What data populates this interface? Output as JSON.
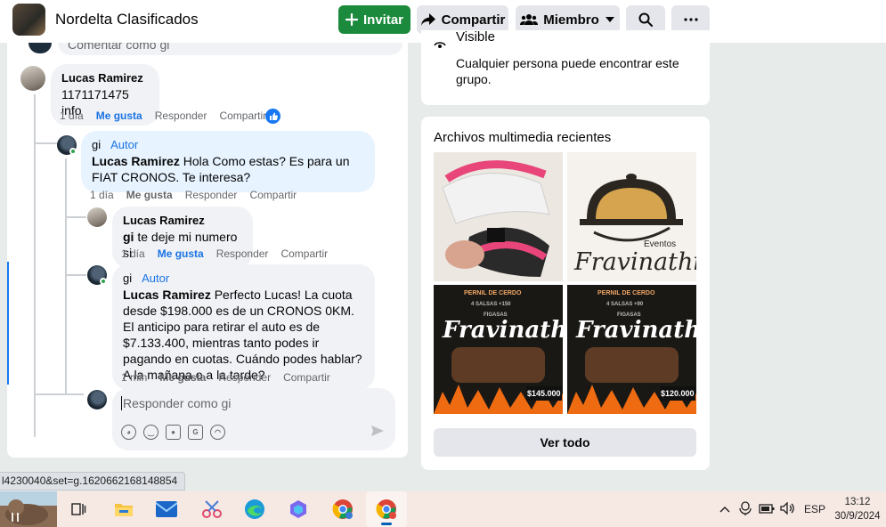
{
  "header": {
    "group_name": "Nordelta Clasificados",
    "invite_label": "Invitar",
    "share_label": "Compartir",
    "member_label": "Miembro"
  },
  "top_comment_box": {
    "placeholder": "Comentar como gi"
  },
  "comments": [
    {
      "author": "Lucas Ramirez",
      "text": "1171171475 info",
      "time": "1 día",
      "like": "Me gusta",
      "reply": "Responder",
      "share": "Compartir"
    },
    {
      "author": "gi",
      "badge": "Autor",
      "mention": "Lucas Ramirez",
      "text": " Hola Como estas? Es para un FIAT CRONOS. Te interesa?",
      "time": "1 día",
      "like": "Me gusta",
      "reply": "Responder",
      "share": "Compartir"
    },
    {
      "author": "Lucas Ramirez",
      "mention": "gi",
      "text": " te deje mi numero si",
      "time": "1 día",
      "like": "Me gusta",
      "reply": "Responder",
      "share": "Compartir"
    },
    {
      "author": "gi",
      "badge": "Autor",
      "mention": "Lucas Ramirez",
      "text": " Perfecto Lucas! La cuota desde $198.000 es de un CRONOS 0KM. El anticipo para retirar el auto es de $7.133.400, mientras tanto podes ir pagando en cuotas. Cuándo podes hablar? A la mañana o a la tarde?",
      "time": "1 min",
      "like": "Me gusta",
      "reply": "Responder",
      "share": "Compartir"
    }
  ],
  "reply_box": {
    "placeholder": "Responder como gi"
  },
  "about": {
    "visibility_title": "Visible",
    "visibility_desc": "Cualquier persona puede encontrar este grupo."
  },
  "media": {
    "title": "Archivos multimedia recientes",
    "see_all": "Ver todo",
    "items": [
      {
        "kind": "photo"
      },
      {
        "kind": "logo",
        "small": "Eventos",
        "brand": "Fravinathi"
      },
      {
        "kind": "menu",
        "top": "PERNIL DE CERDO",
        "sub": "4 SALSAS +150",
        "sub2": "FIGASAS",
        "brand": "Fravinathi",
        "price": "$145.000"
      },
      {
        "kind": "menu",
        "top": "PERNIL DE CERDO",
        "sub": "4 SALSAS +90",
        "sub2": "FIGASAS",
        "brand": "Fravinathi",
        "price": "$120.000"
      }
    ]
  },
  "status_url": "l4230040&set=g.1620662168148854",
  "taskbar": {
    "language": "ESP",
    "time": "13:12",
    "date": "30/9/2024"
  },
  "colors": {
    "accent": "#1b74e4",
    "invite_green": "#1b8a3c",
    "online": "#31a24c"
  }
}
